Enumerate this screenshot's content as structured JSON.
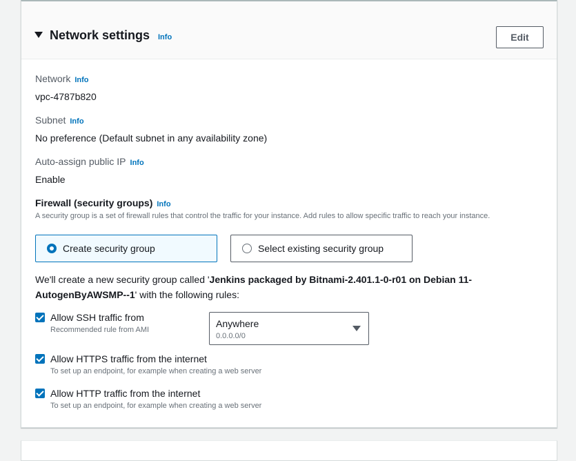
{
  "section": {
    "title": "Network settings",
    "info": "Info",
    "edit_label": "Edit"
  },
  "network": {
    "label": "Network",
    "info": "Info",
    "value": "vpc-4787b820"
  },
  "subnet": {
    "label": "Subnet",
    "info": "Info",
    "value": "No preference (Default subnet in any availability zone)"
  },
  "public_ip": {
    "label": "Auto-assign public IP",
    "info": "Info",
    "value": "Enable"
  },
  "firewall": {
    "label": "Firewall (security groups)",
    "info": "Info",
    "description": "A security group is a set of firewall rules that control the traffic for your instance. Add rules to allow specific traffic to reach your instance.",
    "options": [
      {
        "label": "Create security group",
        "selected": true
      },
      {
        "label": "Select existing security group",
        "selected": false
      }
    ],
    "note_prefix": "We'll create a new security group called '",
    "group_name": "Jenkins packaged by Bitnami-2.401.1-0-r01 on Debian 11-AutogenByAWSMP--1",
    "note_suffix": "' with the following rules:"
  },
  "rules": [
    {
      "label": "Allow SSH traffic from",
      "description": "Recommended rule from AMI",
      "checked": true
    },
    {
      "label": "Allow HTTPS traffic from the internet",
      "description": "To set up an endpoint, for example when creating a web server",
      "checked": true
    },
    {
      "label": "Allow HTTP traffic from the internet",
      "description": "To set up an endpoint, for example when creating a web server",
      "checked": true
    }
  ],
  "ssh_source": {
    "value": "Anywhere",
    "sub": "0.0.0.0/0"
  },
  "colors": {
    "accent": "#0073bb",
    "text": "#16191f",
    "muted": "#687078"
  }
}
